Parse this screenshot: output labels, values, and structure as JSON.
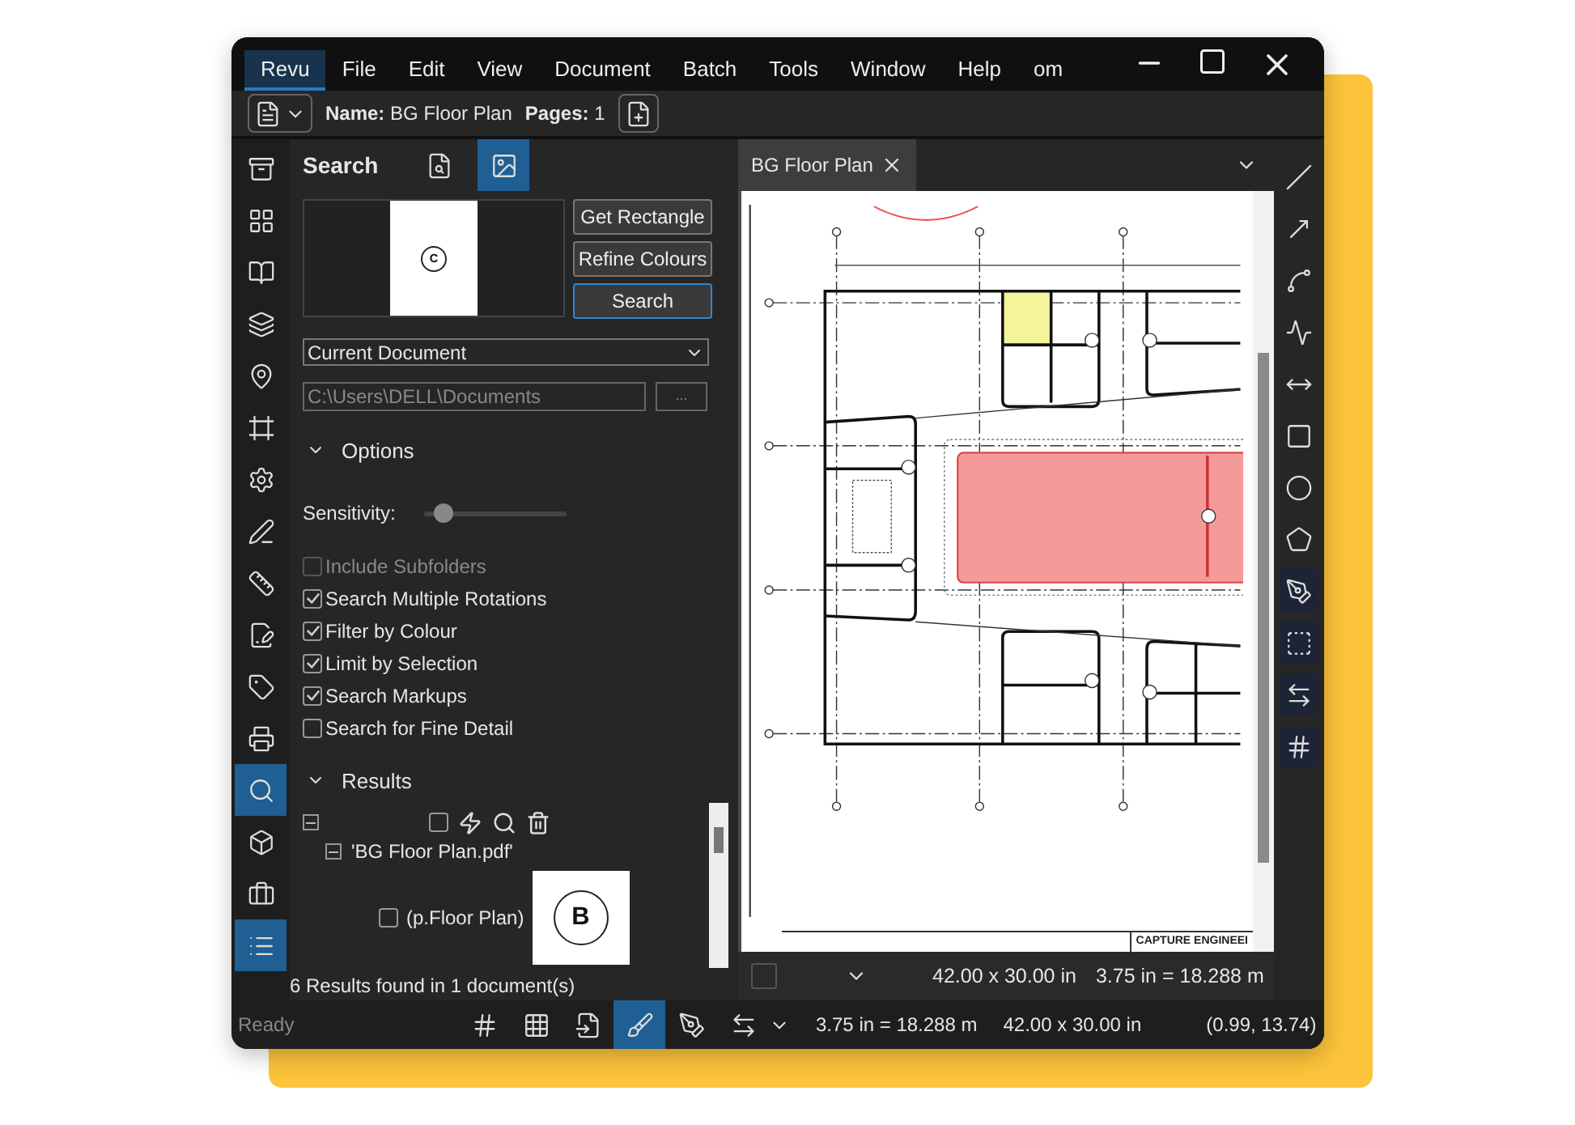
{
  "menu": [
    {
      "label": "Revu",
      "selected": true
    },
    {
      "label": "File",
      "selected": false
    },
    {
      "label": "Edit",
      "selected": false
    },
    {
      "label": "View",
      "selected": false
    },
    {
      "label": "Document",
      "selected": false
    },
    {
      "label": "Batch",
      "selected": false
    },
    {
      "label": "Tools",
      "selected": false
    },
    {
      "label": "Window",
      "selected": false
    },
    {
      "label": "Help",
      "selected": false
    },
    {
      "label": "om",
      "selected": false
    }
  ],
  "toolbar": {
    "name_label": "Name:",
    "name": "BG Floor Plan",
    "pages_label": "Pages:",
    "pages": "1"
  },
  "left_rail": [
    {
      "kind": "cabinet",
      "selected": false
    },
    {
      "kind": "thumbnails",
      "selected": false
    },
    {
      "kind": "bookmarks",
      "selected": false
    },
    {
      "kind": "layers",
      "selected": false
    },
    {
      "kind": "places",
      "selected": false
    },
    {
      "kind": "spaces",
      "selected": false
    },
    {
      "kind": "settings",
      "selected": false
    },
    {
      "kind": "signature",
      "selected": false
    },
    {
      "kind": "measure",
      "selected": false
    },
    {
      "kind": "forms",
      "selected": false
    },
    {
      "kind": "tag",
      "selected": false
    },
    {
      "kind": "scanner",
      "selected": false
    },
    {
      "kind": "search",
      "selected": true
    },
    {
      "kind": "model",
      "selected": false
    },
    {
      "kind": "toolbox",
      "selected": false
    },
    {
      "kind": "list",
      "selected": true
    }
  ],
  "search_panel": {
    "title": "Search",
    "modes": [
      {
        "kind": "text",
        "selected": false
      },
      {
        "kind": "image",
        "selected": true
      }
    ],
    "preview_mark": "C",
    "buttons": [
      {
        "label": "Get Rectangle",
        "focused": false
      },
      {
        "label": "Refine Colours",
        "focused": false
      },
      {
        "label": "Search",
        "focused": true
      }
    ],
    "scope": "Current Document",
    "path": "C:\\Users\\DELL\\Documents",
    "browse": "...",
    "options": {
      "title": "Options",
      "expanded": true,
      "sensitivity_label": "Sensitivity:",
      "level": 0.13,
      "checkboxes": [
        {
          "label": "Include Subfolders",
          "checked": false,
          "disabled": true
        },
        {
          "label": "Search Multiple Rotations",
          "checked": true,
          "disabled": false
        },
        {
          "label": "Filter by Colour",
          "checked": true,
          "disabled": false
        },
        {
          "label": "Limit by Selection",
          "checked": true,
          "disabled": false
        },
        {
          "label": "Search Markups",
          "checked": true,
          "disabled": false
        },
        {
          "label": "Search for Fine Detail",
          "checked": false,
          "disabled": false
        }
      ]
    },
    "results": {
      "title": "Results",
      "expanded": true,
      "select_all": false,
      "file": {
        "name": "'BG Floor Plan.pdf'",
        "expanded": true,
        "children": [
          {
            "label": "(p.Floor Plan)",
            "checked": false,
            "thumb_mark": "B"
          }
        ]
      },
      "summary": "6 Results found in 1 document(s)"
    }
  },
  "document": {
    "tab": "BG Floor Plan",
    "page_checkbox": false,
    "title_block": "CAPTURE ENGINEEI",
    "size": "42.00 x 30.00 in",
    "scale": "3.75 in = 18.288 m"
  },
  "right_tools": [
    {
      "kind": "line",
      "highlighted": false
    },
    {
      "kind": "arrow",
      "highlighted": false
    },
    {
      "kind": "arc",
      "highlighted": false
    },
    {
      "kind": "polyline",
      "highlighted": false
    },
    {
      "kind": "dimension",
      "highlighted": false
    },
    {
      "kind": "rectangle",
      "highlighted": false
    },
    {
      "kind": "ellipse",
      "highlighted": false
    },
    {
      "kind": "polygon",
      "highlighted": false
    },
    {
      "kind": "length",
      "highlighted": true
    },
    {
      "kind": "area",
      "highlighted": true
    },
    {
      "kind": "span",
      "highlighted": true
    },
    {
      "kind": "count",
      "highlighted": true
    }
  ],
  "status_bar": {
    "state": "Ready",
    "tools": [
      {
        "kind": "grid",
        "selected": false
      },
      {
        "kind": "snap-grid",
        "selected": false
      },
      {
        "kind": "snap-content",
        "selected": false
      },
      {
        "kind": "snap-markup",
        "selected": true
      },
      {
        "kind": "reuse",
        "selected": false
      }
    ],
    "scale": "3.75 in = 18.288 m",
    "size": "42.00 x 30.00 in",
    "coords": "(0.99, 13.74)"
  }
}
